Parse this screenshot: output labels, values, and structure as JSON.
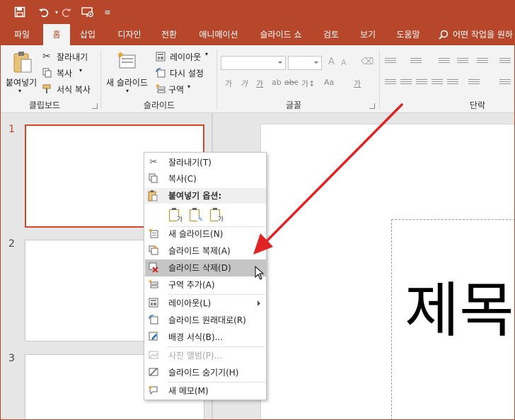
{
  "qat": {
    "icons": [
      "save-icon",
      "undo-icon",
      "redo-icon",
      "present-from-beginning-icon",
      "customize-qat-icon"
    ]
  },
  "tabs": [
    {
      "label": "파일",
      "active": false
    },
    {
      "label": "홈",
      "active": true
    },
    {
      "label": "삽입",
      "active": false
    },
    {
      "label": "디자인",
      "active": false
    },
    {
      "label": "전환",
      "active": false
    },
    {
      "label": "애니메이션",
      "active": false
    },
    {
      "label": "슬라이드 쇼",
      "active": false
    },
    {
      "label": "검토",
      "active": false
    },
    {
      "label": "보기",
      "active": false
    },
    {
      "label": "도움말",
      "active": false
    }
  ],
  "tell_me": "어떤 작업을 원하",
  "ribbon": {
    "clipboard": {
      "label": "클립보드",
      "paste": "붙여넣기",
      "cut": "잘라내기",
      "copy": "복사",
      "format_painter": "서식 복사"
    },
    "slides": {
      "label": "슬라이드",
      "new_slide": "새 슬라이드",
      "layout": "레이아웃",
      "reset": "다시 설정",
      "section": "구역"
    },
    "font": {
      "label": "글꼴",
      "glyphs": [
        "가",
        "가",
        "가",
        "ab",
        "abc",
        "가↕",
        "Aa",
        "가"
      ]
    },
    "paragraph": {
      "label": "단락"
    }
  },
  "slides": {
    "numbers": [
      "1",
      "2",
      "3"
    ],
    "selected": 1,
    "main_title": "제목"
  },
  "context_menu": {
    "items": [
      {
        "label": "잘라내기(T)",
        "icon": "scissors-icon"
      },
      {
        "label": "복사(C)",
        "icon": "copy-icon"
      },
      {
        "label": "붙여넣기 옵션:",
        "icon": "paste-icon"
      },
      {
        "label": "새 슬라이드(N)",
        "icon": "new-slide-icon"
      },
      {
        "label": "슬라이드 복제(A)",
        "icon": "duplicate-slide-icon"
      },
      {
        "label": "슬라이드 삭제(D)",
        "icon": "delete-slide-icon",
        "hover": true
      },
      {
        "label": "구역 추가(A)",
        "icon": "add-section-icon"
      },
      {
        "label": "레이아웃(L)",
        "icon": "layout-icon",
        "submenu": true
      },
      {
        "label": "슬라이드 원래대로(R)",
        "icon": "reset-slide-icon"
      },
      {
        "label": "배경 서식(B)...",
        "icon": "format-background-icon"
      },
      {
        "label": "사진 앨범(P)...",
        "icon": "photo-album-icon",
        "disabled": true
      },
      {
        "label": "슬라이드 숨기기(H)",
        "icon": "hide-slide-icon"
      },
      {
        "label": "새 메모(M)",
        "icon": "new-comment-icon"
      }
    ],
    "paste_options": [
      {
        "icon": "paste-use-destination-theme-icon",
        "sub": "가"
      },
      {
        "icon": "paste-keep-source-formatting-icon",
        "sub": "✎"
      },
      {
        "icon": "paste-keep-text-only-icon",
        "sub": "가"
      }
    ]
  },
  "colors": {
    "accent": "#b7472a",
    "selection": "#d24726",
    "annotation_arrow": "#e02424"
  }
}
